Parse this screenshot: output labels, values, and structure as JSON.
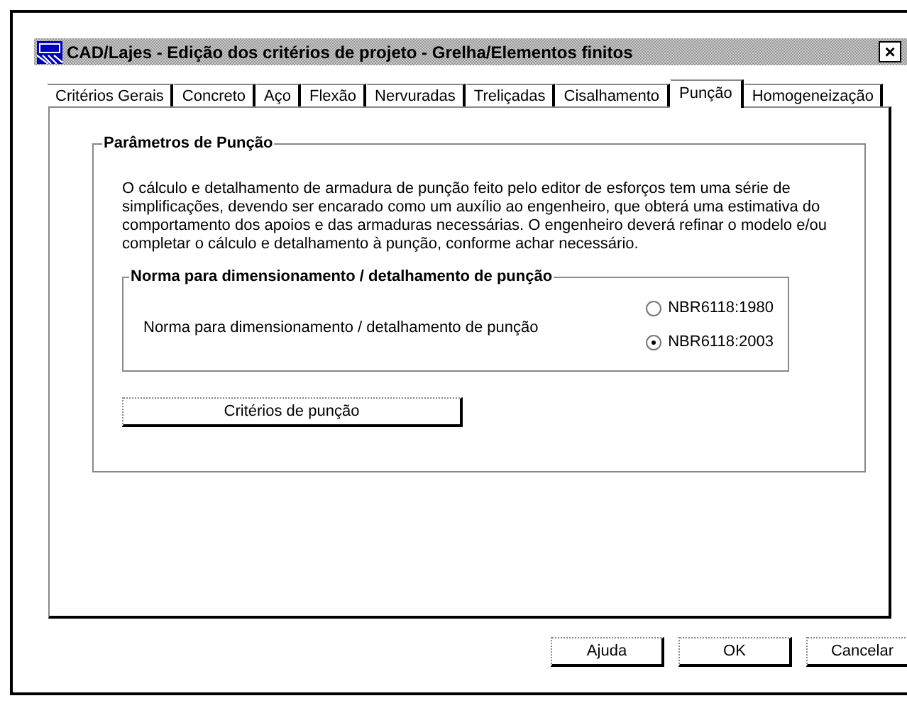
{
  "window": {
    "title": "CAD/Lajes - Edição dos critérios de projeto - Grelha/Elementos finitos",
    "close": "×"
  },
  "tabs": [
    {
      "label": "Critérios Gerais",
      "selected": false
    },
    {
      "label": "Concreto",
      "selected": false
    },
    {
      "label": "Aço",
      "selected": false
    },
    {
      "label": "Flexão",
      "selected": false
    },
    {
      "label": "Nervuradas",
      "selected": false
    },
    {
      "label": "Treliçadas",
      "selected": false
    },
    {
      "label": "Cisalhamento",
      "selected": false
    },
    {
      "label": "Punção",
      "selected": true
    },
    {
      "label": "Homogeneização",
      "selected": false
    }
  ],
  "group": {
    "title": "Parâmetros de Punção",
    "description": "O cálculo e detalhamento de armadura de punção feito pelo editor de esforços tem uma série de simplificações, devendo ser encarado como um auxílio ao engenheiro, que obterá uma estimativa do comportamento dos apoios e das armaduras necessárias. O engenheiro deverá refinar o modelo e/ou completar o cálculo e detalhamento à punção, conforme achar necessário.",
    "norm_group": {
      "title": "Norma para dimensionamento / detalhamento de punção",
      "label": "Norma para dimensionamento / detalhamento de punção",
      "options": [
        {
          "label": "NBR6118:1980",
          "selected": false
        },
        {
          "label": "NBR6118:2003",
          "selected": true
        }
      ]
    },
    "button": "Critérios de punção"
  },
  "buttons": [
    "Ajuda",
    "OK",
    "Cancelar"
  ]
}
